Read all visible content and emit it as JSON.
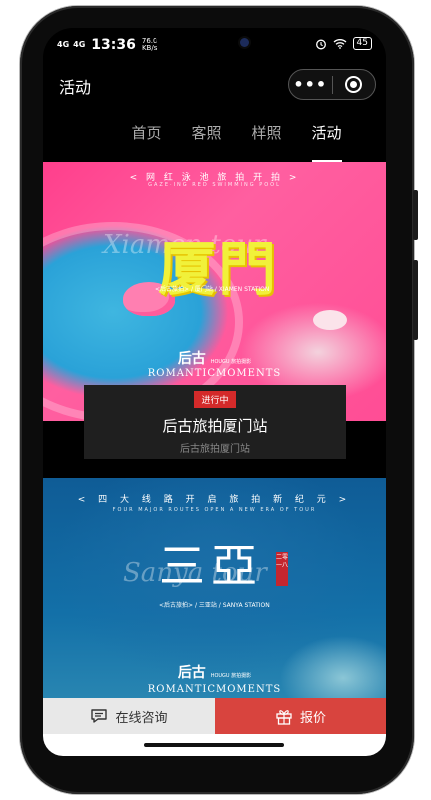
{
  "status_bar": {
    "signal1": "4G",
    "signal2": "4G",
    "time": "13:36",
    "net_speed": "76.0",
    "net_speed_unit": "KB/s",
    "battery": "45"
  },
  "navbar": {
    "title": "活动",
    "more_glyph": "•••"
  },
  "tabs": [
    {
      "label": "首页",
      "active": false
    },
    {
      "label": "客照",
      "active": false
    },
    {
      "label": "样照",
      "active": false
    },
    {
      "label": "活动",
      "active": true
    }
  ],
  "banner1": {
    "top_text": "< 网 红 泳 池 旅 拍 开 拍 >",
    "top_subtext": "GAZE·ING RED SWIMMING POOL",
    "title": "厦門",
    "script": "Xiamen tour",
    "subtitle": "<后古旅拍> / 厦门站 / XIAMEN STATION",
    "brand": "后古",
    "brand_small": "HOUGU 旅拍摄影",
    "tagline": "ROMANTICMOMENTS"
  },
  "card1": {
    "badge": "进行中",
    "title": "后古旅拍厦门站",
    "subtitle": "后古旅拍厦门站"
  },
  "banner2": {
    "top_text": "< 四 大 线 路 开 启 旅 拍 新 纪 元 >",
    "top_subtext": "FOUR MAJOR ROUTES OPEN A NEW ERA OF TOUR",
    "title": "三亞",
    "script": "Sanya tour",
    "seal": "二零一八",
    "subtitle": "<后古旅拍> / 三亚站 / SANYA STATION",
    "brand": "后古",
    "brand_small": "HOUGU 旅拍摄影",
    "tagline": "ROMANTICMOMENTS"
  },
  "bottom_bar": {
    "consult_label": "在线咨询",
    "quote_label": "报价"
  },
  "colors": {
    "accent_red": "#d8443e",
    "badge_red": "#d42a2a"
  },
  "icons": {
    "consult": "chat-icon",
    "quote": "gift-icon"
  }
}
